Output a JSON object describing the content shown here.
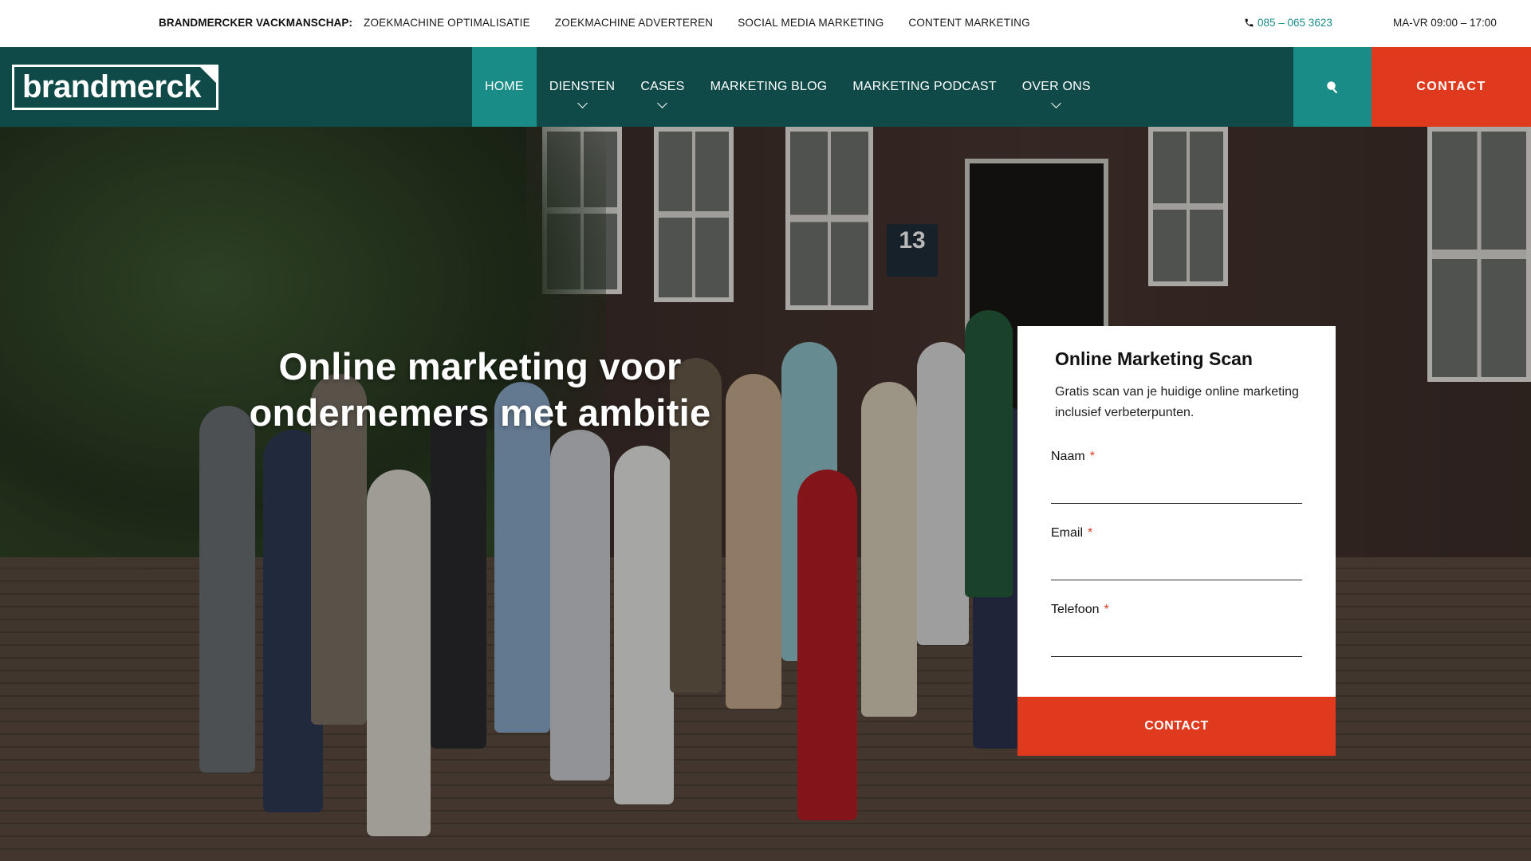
{
  "topbar": {
    "lead": "BRANDMERCKER VACKMANSCHAP:",
    "links": [
      "ZOEKMACHINE OPTIMALISATIE",
      "ZOEKMACHINE ADVERTEREN",
      "SOCIAL MEDIA MARKETING",
      "CONTENT MARKETING"
    ],
    "phone": "085 – 065 3623",
    "hours": "MA-VR 09:00 – 17:00"
  },
  "nav": {
    "logo": "brandmerck",
    "items": [
      {
        "label": "HOME"
      },
      {
        "label": "DIENSTEN"
      },
      {
        "label": "CASES"
      },
      {
        "label": "MARKETING BLOG"
      },
      {
        "label": "MARKETING PODCAST"
      },
      {
        "label": "OVER ONS"
      }
    ],
    "contact": "CONTACT"
  },
  "hero": {
    "headline_1": "Online marketing voor",
    "headline_2": "ondernemers met ambitie",
    "sign_number": "13"
  },
  "form": {
    "title": "Online Marketing Scan",
    "description": "Gratis scan van je huidige online marketing inclusief verbeterpunten.",
    "fields": [
      {
        "label": "Naam",
        "required": "*",
        "value": ""
      },
      {
        "label": "Email",
        "required": "*",
        "value": ""
      },
      {
        "label": "Telefoon",
        "required": "*",
        "value": ""
      }
    ],
    "submit": "CONTACT"
  },
  "colors": {
    "nav_bg": "#0f4a48",
    "accent_teal": "#1a8c87",
    "accent_red": "#e03a1e"
  },
  "icons": {
    "phone": "phone-icon",
    "search": "search-icon",
    "chevron": "chevron-down-icon"
  }
}
